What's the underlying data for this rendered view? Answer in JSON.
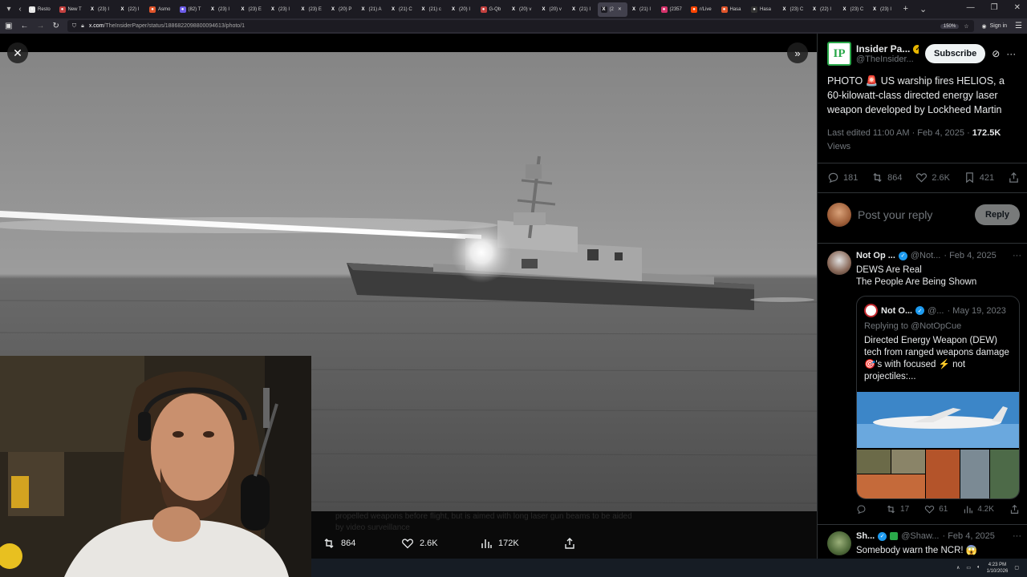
{
  "browser": {
    "tabs": [
      {
        "label": "Resto",
        "color": "#e6e6e6",
        "glyph": "●"
      },
      {
        "label": "New T",
        "color": "#c4413f",
        "glyph": "●"
      },
      {
        "label": "(23) I",
        "color": "#1c1b22",
        "glyph": "X"
      },
      {
        "label": "(22) I",
        "color": "#1c1b22",
        "glyph": "X"
      },
      {
        "label": "Asmo",
        "color": "#e0552b",
        "glyph": "●"
      },
      {
        "label": "(82) T",
        "color": "#6c5ce7",
        "glyph": "●"
      },
      {
        "label": "(23) I",
        "color": "#1c1b22",
        "glyph": "X"
      },
      {
        "label": "(23) E",
        "color": "#1c1b22",
        "glyph": "X"
      },
      {
        "label": "(23) I",
        "color": "#1c1b22",
        "glyph": "X"
      },
      {
        "label": "(23) E",
        "color": "#1c1b22",
        "glyph": "X"
      },
      {
        "label": "(20) P",
        "color": "#1c1b22",
        "glyph": "X"
      },
      {
        "label": "(21) A",
        "color": "#1c1b22",
        "glyph": "X"
      },
      {
        "label": "(21) C",
        "color": "#1c1b22",
        "glyph": "X"
      },
      {
        "label": "(21) c",
        "color": "#1c1b22",
        "glyph": "X"
      },
      {
        "label": "(20) I",
        "color": "#1c1b22",
        "glyph": "X"
      },
      {
        "label": "G-Qb",
        "color": "#c4413f",
        "glyph": "●"
      },
      {
        "label": "(20) v",
        "color": "#1c1b22",
        "glyph": "X"
      },
      {
        "label": "(20) v",
        "color": "#1c1b22",
        "glyph": "X"
      },
      {
        "label": "(21) I",
        "color": "#1c1b22",
        "glyph": "X"
      },
      {
        "label": "(2",
        "color": "#1c1b22",
        "glyph": "X"
      },
      {
        "label": "(21) I",
        "color": "#1c1b22",
        "glyph": "X"
      },
      {
        "label": "(2357",
        "color": "#d6336c",
        "glyph": "●"
      },
      {
        "label": "r/Live",
        "color": "#ff4500",
        "glyph": "●"
      },
      {
        "label": "Hasa",
        "color": "#e0552b",
        "glyph": "●"
      },
      {
        "label": "Hasa",
        "color": "#333",
        "glyph": "●"
      },
      {
        "label": "(23) C",
        "color": "#1c1b22",
        "glyph": "X"
      },
      {
        "label": "(22) I",
        "color": "#1c1b22",
        "glyph": "X"
      },
      {
        "label": "(23) C",
        "color": "#1c1b22",
        "glyph": "X"
      },
      {
        "label": "(23) I",
        "color": "#1c1b22",
        "glyph": "X"
      }
    ],
    "active_tab_index": 19,
    "url_host": "x.com",
    "url_path": "/TheInsiderPaper/status/1886822098800094613/photo/1",
    "zoom": "150%",
    "sign_in": "Sign in"
  },
  "media": {
    "alt_hidden_text": "propelled weapons before flight, but is aimed with long laser gun beams to be aided by video surveillance",
    "reposts": "864",
    "likes": "2.6K",
    "views": "172K"
  },
  "tray": {
    "time": "4:23 PM",
    "date": "1/10/2026"
  },
  "tweet": {
    "author_name": "Insider Pa...",
    "author_handle": "@TheInsider...",
    "avatar_text": "IP",
    "subscribe_label": "Subscribe",
    "text": "PHOTO 🚨 US warship fires HELIOS, a 60-kilowatt-class directed energy laser weapon developed by Lockheed Martin",
    "edited": "Last edited 11:00 AM · Feb 4, 2025 · ",
    "views_count": "172.5K",
    "views_label": "Views",
    "replies": "181",
    "reposts": "864",
    "likes": "2.6K",
    "bookmarks": "421",
    "reply_placeholder": "Post your reply",
    "reply_button": "Reply"
  },
  "replies": [
    {
      "name": "Not Op ...",
      "handle": "@Not...",
      "date": "· Feb 4, 2025",
      "line1": "DEWS Are Real",
      "line2": "The People Are Being Shown",
      "quote": {
        "name": "Not O...",
        "handle": "@...",
        "date": "· May 19, 2023",
        "replying": "Replying to @NotOpCue",
        "text": "Directed Energy Weapon (DEW) tech from ranged weapons damage 🎯's with focused ⚡ not projectiles:..."
      },
      "stats": {
        "replies": "",
        "reposts": "17",
        "likes": "61",
        "views": "4.2K"
      }
    },
    {
      "name": "Sh...",
      "handle": "@Shaw...",
      "date": "· Feb 4, 2025",
      "text": "Somebody warn the NCR! 😱"
    }
  ],
  "colors": {
    "accent_blue": "#1d9bf0",
    "verified_gold": "#e8b600",
    "ip_green": "#2aa84a",
    "text_primary": "#e7e9ea",
    "text_secondary": "#71767b"
  }
}
